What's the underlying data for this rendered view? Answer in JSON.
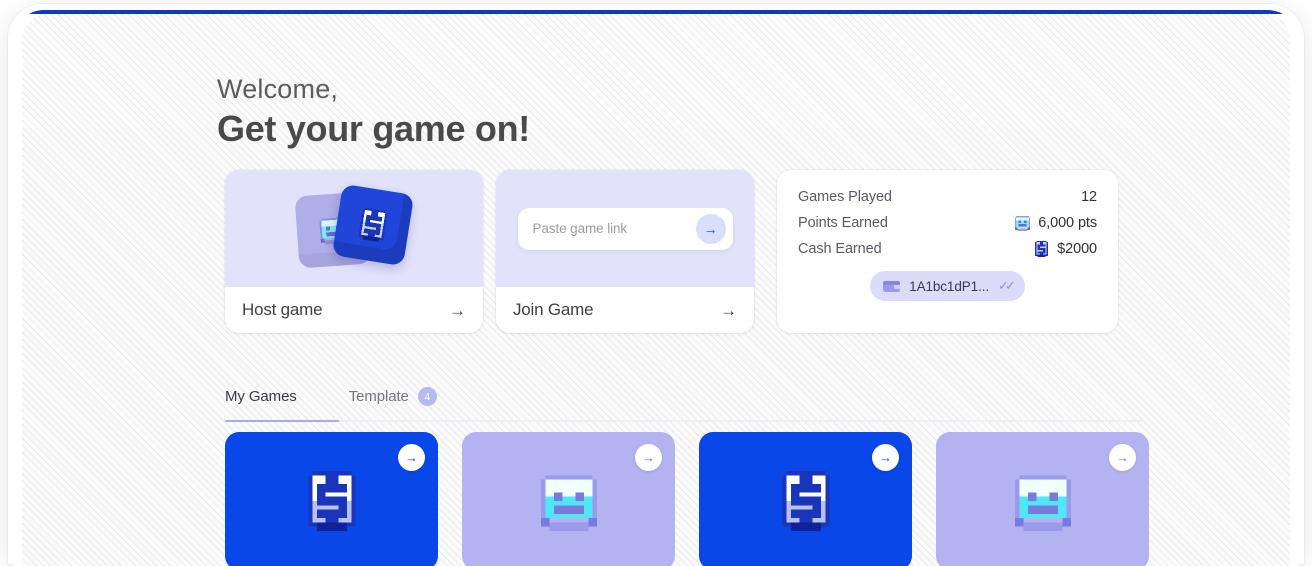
{
  "window": {
    "accent_bar_color": "#1038c4",
    "background_color": "#fcfcfc"
  },
  "header": {
    "greeting": "Welcome,",
    "title": "Get your game on!"
  },
  "action_cards": [
    {
      "id": "host-game",
      "label": "Host game",
      "arrow_icon": "arrow-right-icon",
      "media": "stacked-game-tiles"
    },
    {
      "id": "join-game",
      "label": "Join Game",
      "arrow_icon": "arrow-right-icon",
      "media": "paste-link-input",
      "input_placeholder": "Paste game link",
      "input_value": "",
      "submit_icon": "arrow-right-icon"
    }
  ],
  "stats": {
    "rows": [
      {
        "label": "Games Played",
        "value": "12",
        "icon": ""
      },
      {
        "label": "Points Earned",
        "value": "6,000 pts",
        "icon": "pixel-smiley-icon"
      },
      {
        "label": "Cash Earned",
        "value": "$2000",
        "icon": "pixel-coin-icon"
      }
    ],
    "wallet": {
      "icon": "wallet-icon",
      "address": "1A1bc1dP1...",
      "verified_icon": "double-check-icon"
    }
  },
  "tabs": {
    "items": [
      {
        "id": "my-games",
        "label": "My Games",
        "active": true,
        "badge": ""
      },
      {
        "id": "template",
        "label": "Template",
        "active": false,
        "badge": "4"
      }
    ],
    "active_underline_color": "#a9a9f4"
  },
  "games": [
    {
      "id": "game-1",
      "theme": "blue",
      "icon": "pixel-coin-icon",
      "bg": "#0a47e8",
      "arrow_icon": "arrow-right-icon"
    },
    {
      "id": "game-2",
      "theme": "purple",
      "icon": "pixel-smiley-icon",
      "bg": "#b3b3f2",
      "arrow_icon": "arrow-right-icon"
    },
    {
      "id": "game-3",
      "theme": "blue",
      "icon": "pixel-coin-icon",
      "bg": "#0a47e8",
      "arrow_icon": "arrow-right-icon"
    },
    {
      "id": "game-4",
      "theme": "purple",
      "icon": "pixel-smiley-icon",
      "bg": "#b3b3f2",
      "arrow_icon": "arrow-right-icon"
    }
  ],
  "glyphs": {
    "arrow_right": "→",
    "double_check": "✓✓"
  }
}
